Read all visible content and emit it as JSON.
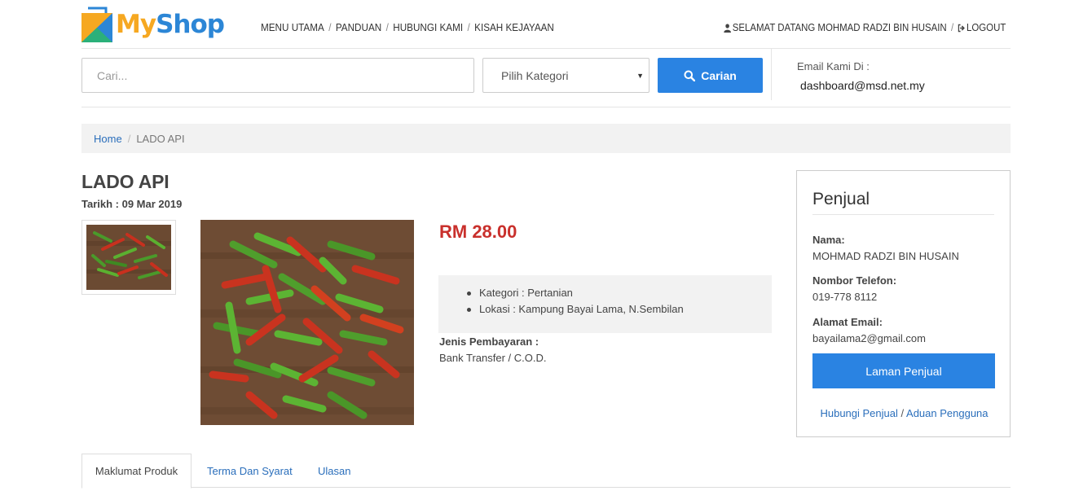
{
  "brand": {
    "part1": "My",
    "part2": "Shop"
  },
  "topnav": {
    "items": [
      "MENU UTAMA",
      "PANDUAN",
      "HUBUNGI KAMI",
      "KISAH KEJAYAAN"
    ],
    "separator": "/"
  },
  "user": {
    "welcome": "SELAMAT DATANG MOHMAD RADZI BIN HUSAIN",
    "logout": "LOGOUT"
  },
  "search": {
    "placeholder": "Cari...",
    "category": "Pilih Kategori",
    "button": "Carian"
  },
  "email_box": {
    "label": "Email Kami Di :",
    "value": "dashboard@msd.net.my"
  },
  "breadcrumb": {
    "home": "Home",
    "separator": "/",
    "current": "LADO API"
  },
  "product": {
    "title": "LADO API",
    "date": "Tarikh : 09 Mar 2019",
    "price": "RM 28.00",
    "details": [
      "Kategori : Pertanian",
      "Lokasi : Kampung Bayai Lama, N.Sembilan"
    ],
    "payment_label": "Jenis Pembayaran :",
    "payment_value": "Bank Transfer / C.O.D."
  },
  "seller": {
    "title": "Penjual",
    "name_label": "Nama:",
    "name": "MOHMAD RADZI BIN HUSAIN",
    "phone_label": "Nombor Telefon:",
    "phone": "019-778 8112",
    "email_label": "Alamat Email:",
    "email": "bayailama2@gmail.com",
    "button": "Laman Penjual",
    "link1": "Hubungi Penjual",
    "link_sep": "/",
    "link2": "Aduan Pengguna"
  },
  "tabs": [
    "Maklumat Produk",
    "Terma Dan Syarat",
    "Ulasan"
  ],
  "colors": {
    "accent": "#2a83e2",
    "price": "#c9302c",
    "brand_orange": "#f6a821",
    "brand_blue": "#2c86d6",
    "link": "#2a6ebb"
  }
}
